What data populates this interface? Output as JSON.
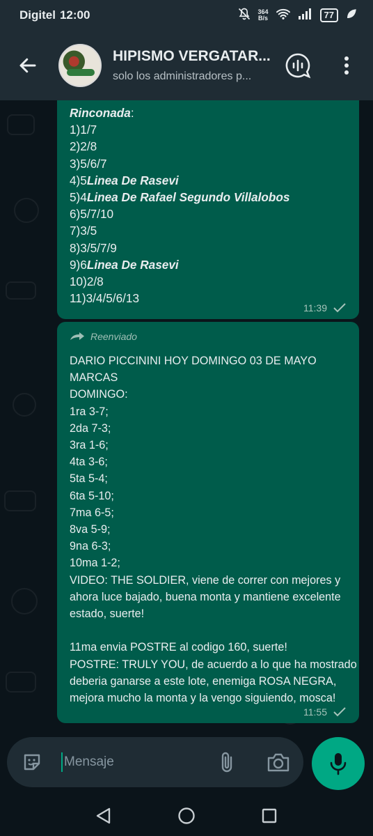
{
  "status_bar": {
    "carrier": "Digitel",
    "time": "12:00",
    "net_speed_value": "364",
    "net_speed_unit": "B/s",
    "battery": "77"
  },
  "header": {
    "group_name": "HIPISMO VERGATAR...",
    "subtitle": "solo los administradores p..."
  },
  "messages": [
    {
      "lines": [
        {
          "text": "Rinconada",
          "style": "bi",
          "suffix": ":"
        },
        {
          "text": "1)1/7"
        },
        {
          "text": "2)2/8"
        },
        {
          "text": "3)5/6/7"
        },
        {
          "prefix": "4)5",
          "text": "Linea De Rasevi",
          "style": "bi"
        },
        {
          "prefix": "5)4",
          "text": "Linea De Rafael Segundo Villalobos",
          "style": "bi"
        },
        {
          "text": "6)5/7/10"
        },
        {
          "text": "7)3/5"
        },
        {
          "text": "8)3/5/7/9"
        },
        {
          "prefix": "9)6",
          "text": "Linea De Rasevi",
          "style": "bi"
        },
        {
          "text": "10)2/8"
        },
        {
          "text": "11)3/4/5/6/13"
        }
      ],
      "time": "11:39"
    },
    {
      "forwarded_label": "Reenviado",
      "lines": [
        "DARIO PICCININI HOY DOMINGO 03 DE MAYO",
        "MARCAS",
        "DOMINGO:",
        "1ra 3-7;",
        "2da 7-3;",
        "3ra 1-6;",
        "4ta 3-6;",
        "5ta 5-4;",
        "6ta 5-10;",
        "7ma 6-5;",
        "8va 5-9;",
        "9na 6-3;",
        "10ma 1-2;",
        "VIDEO: THE SOLDIER, viene de correr con mejores y",
        "ahora luce bajado, buena monta y mantiene excelente",
        "estado, suerte!",
        "",
        "  11ma envia POSTRE al codigo 160, suerte!",
        "POSTRE: TRULY YOU, de acuerdo a lo que ha mostrado",
        "deberia ganarse a este lote, enemiga ROSA NEGRA,",
        "mejora mucho la monta y la vengo siguiendo, mosca!"
      ],
      "time": "11:55"
    }
  ],
  "input": {
    "placeholder": "Mensaje"
  },
  "colors": {
    "bubble_out": "#005c4b",
    "accent": "#00a884",
    "bar": "#1f2c34",
    "bg": "#0b141a"
  },
  "icons": [
    "back-arrow-icon",
    "voice-chat-icon",
    "more-vert-icon",
    "sticker-icon",
    "attach-icon",
    "camera-icon",
    "mic-icon",
    "nav-back-icon",
    "nav-home-icon",
    "nav-recents-icon"
  ]
}
